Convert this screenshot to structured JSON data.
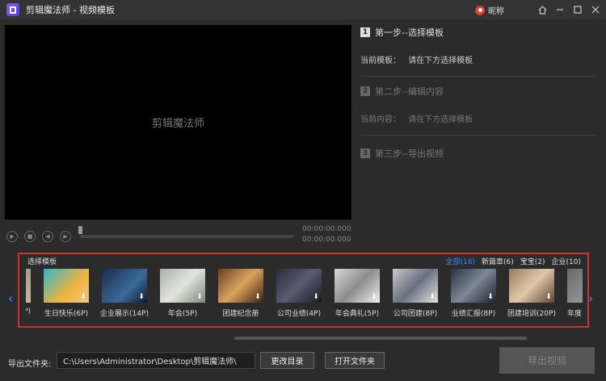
{
  "window": {
    "title": "剪辑魔法师 - 视频模板",
    "user_name": "昵称",
    "icons": [
      "home-icon",
      "minimize-icon",
      "maximize-icon",
      "close-icon"
    ]
  },
  "preview": {
    "watermark": "剪辑魔法师",
    "time_current": "00:00:00.000",
    "time_total": "00:00:00.000"
  },
  "steps": [
    {
      "num": "1",
      "title": "第一步--选择模板",
      "label": "当前模板：",
      "value": "请在下方选择模板"
    },
    {
      "num": "2",
      "title": "第二步--编辑内容",
      "label": "当前内容：",
      "value": "请在下方选择模板"
    },
    {
      "num": "3",
      "title": "第三步--导出视频"
    }
  ],
  "templates": {
    "title": "选择模板",
    "categories": [
      "全部(18)",
      "新篇章(6)",
      "宝宝(2)",
      "企业(10)"
    ],
    "items": [
      {
        "label": "P)"
      },
      {
        "label": "生日快乐(6P)"
      },
      {
        "label": "企业展示(14P)"
      },
      {
        "label": "年会(5P)"
      },
      {
        "label": "团建纪念册"
      },
      {
        "label": "公司业绩(4P)"
      },
      {
        "label": "年会典礼(5P)"
      },
      {
        "label": "公司团建(8P)"
      },
      {
        "label": "业绩汇报(8P)"
      },
      {
        "label": "团建培训(20P)"
      },
      {
        "label": "年度"
      }
    ],
    "colors": {
      "accent": "#3d8bff",
      "highlight_border": "#d32f2f"
    }
  },
  "bottom": {
    "export_label": "导出文件夹:",
    "path": "C:\\Users\\Administrator\\Desktop\\剪辑魔法师\\",
    "change_dir": "更改目录",
    "open_folder": "打开文件夹",
    "export_video": "导出视频"
  }
}
